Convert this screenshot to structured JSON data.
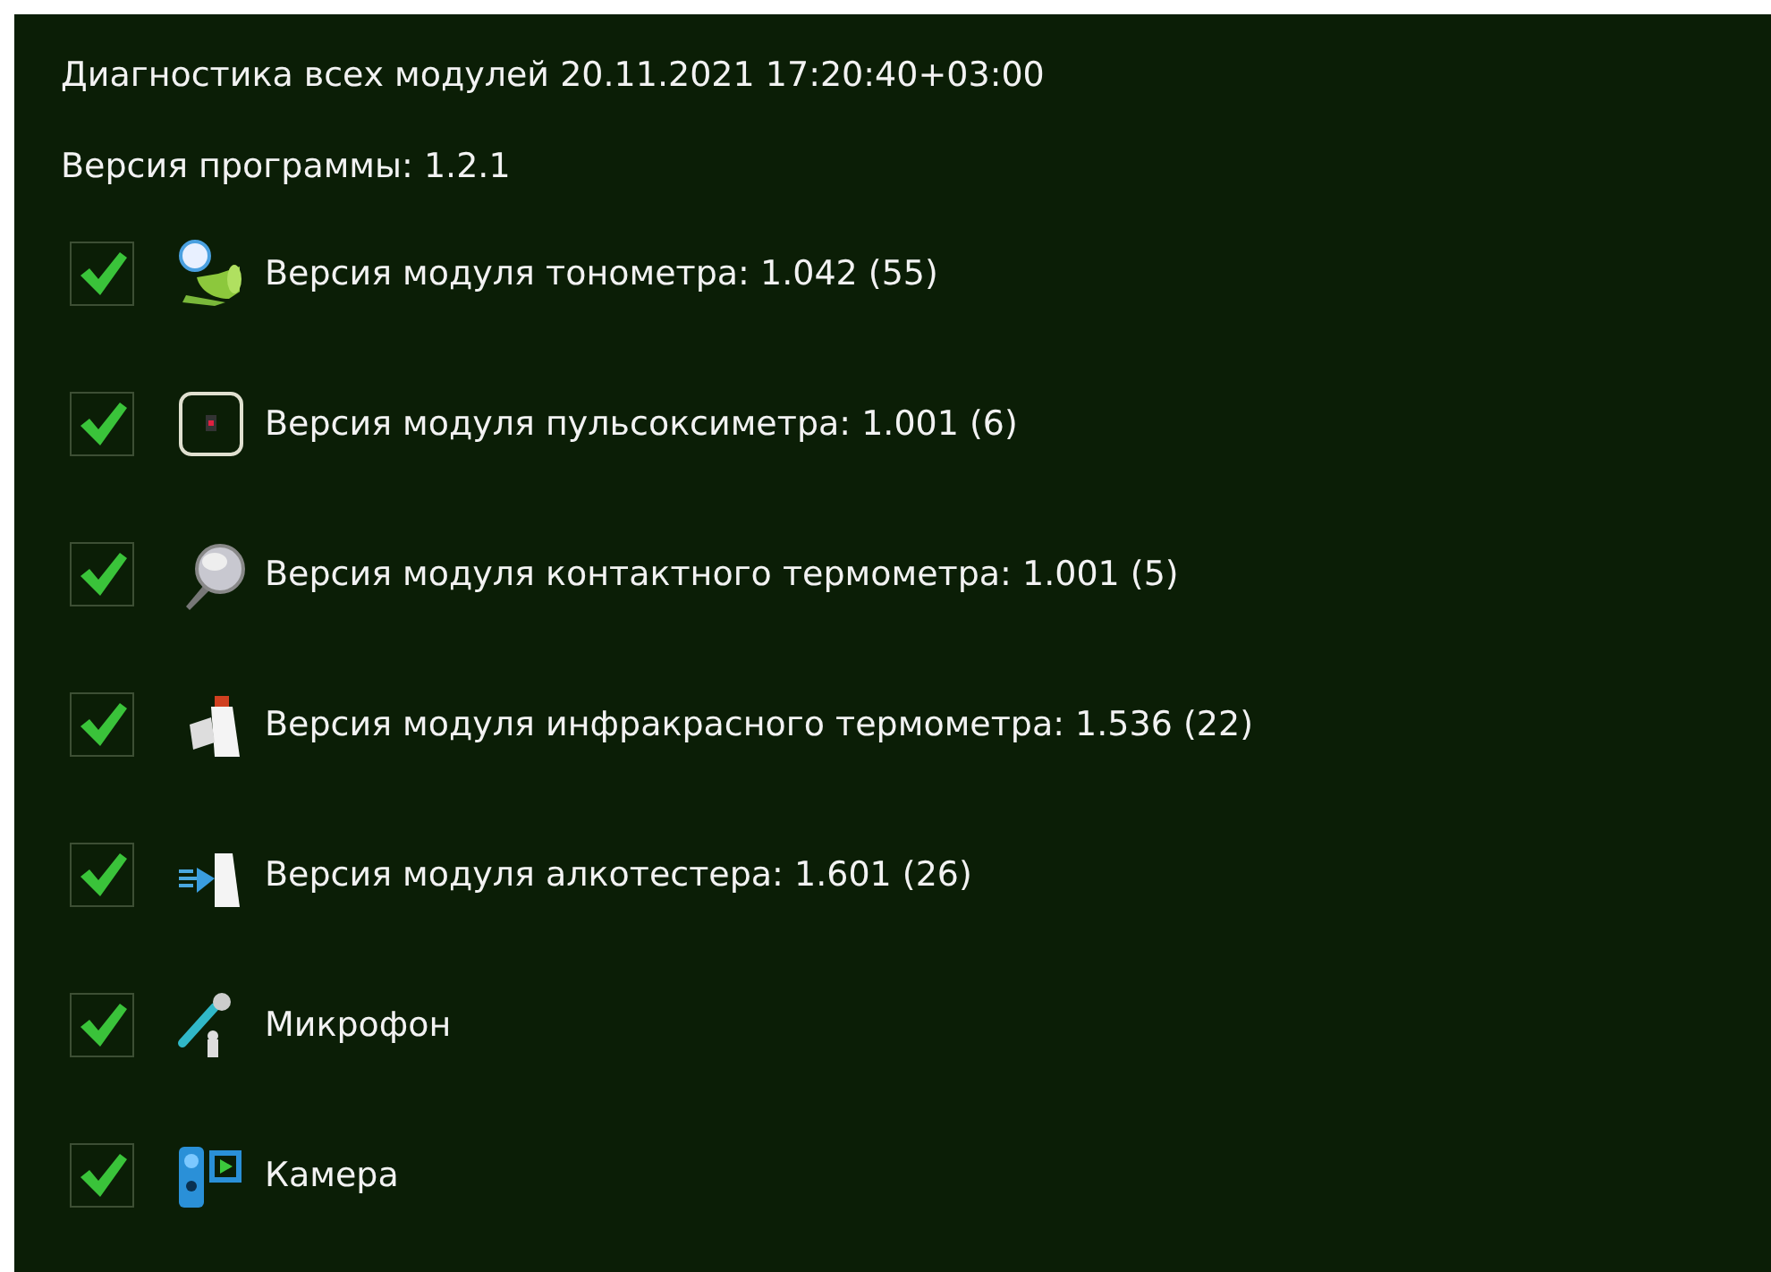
{
  "title": "Диагностика всех модулей 20.11.2021 17:20:40+03:00",
  "program_version": "Версия программы: 1.2.1",
  "modules": [
    {
      "kind": "tonometer",
      "label": "Версия модуля тонометра:  1.042 (55)",
      "checked": true
    },
    {
      "kind": "oximeter",
      "label": "Версия модуля пульсоксиметра:  1.001 (6)",
      "checked": true
    },
    {
      "kind": "thermometer",
      "label": "Версия модуля контактного термометра:  1.001 (5)",
      "checked": true
    },
    {
      "kind": "ir_thermometer",
      "label": "Версия модуля инфракрасного термометра:  1.536 (22)",
      "checked": true
    },
    {
      "kind": "breathalyzer",
      "label": "Версия модуля алкотестера:  1.601 (26)",
      "checked": true
    },
    {
      "kind": "microphone",
      "label": "Микрофон",
      "checked": true
    },
    {
      "kind": "camera",
      "label": "Камера",
      "checked": true
    }
  ]
}
